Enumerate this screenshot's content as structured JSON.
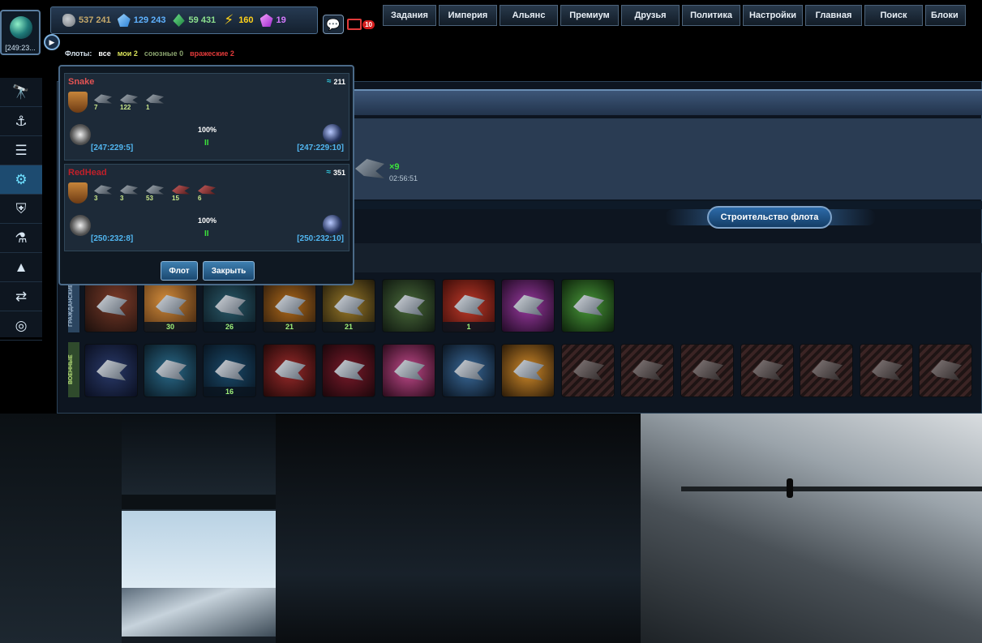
{
  "planet": {
    "coords": "[249:23..."
  },
  "resources": [
    {
      "name": "metal",
      "value": "537 241",
      "color": "#c4a86a",
      "icon": "metal-icon"
    },
    {
      "name": "crystal",
      "value": "129 243",
      "color": "#5fb2ff",
      "icon": "crystal-icon"
    },
    {
      "name": "deuterium",
      "value": "59 431",
      "color": "#8ce08e",
      "icon": "deuterium-icon"
    },
    {
      "name": "energy",
      "value": "160",
      "color": "#ffd21a",
      "icon": "energy-icon"
    },
    {
      "name": "dark_matter",
      "value": "19",
      "color": "#d77aff",
      "icon": "dark-matter-icon"
    }
  ],
  "mail": {
    "count": "10"
  },
  "fleets": {
    "label": "Флоты:",
    "all": "все",
    "my": "мои 2",
    "ally": "союзные 0",
    "enemy": "вражеские 2"
  },
  "nav": [
    "Задания",
    "Империя",
    "Альянс",
    "Премиум",
    "Друзья",
    "Политика",
    "Настройки",
    "Главная",
    "Поиск",
    "Блоки"
  ],
  "sidebar": [
    "galaxy-icon",
    "buildings-icon",
    "list-icon",
    "gear-icon",
    "shield-icon",
    "research-icon",
    "rocket-icon",
    "trade-icon",
    "target-icon"
  ],
  "popup": {
    "fleets": [
      {
        "name": "Snake",
        "power": "211",
        "ships": [
          "7",
          "122",
          "1"
        ],
        "percent": "100%",
        "progress": "II",
        "from": "[247:229:5]",
        "to": "[247:229:10]"
      },
      {
        "name": "RedHead",
        "power": "351",
        "ships": [
          "3",
          "3",
          "53",
          "15",
          "6"
        ],
        "percent": "100%",
        "progress": "II",
        "from": "[250:232:8]",
        "to": "[250:232:10]"
      }
    ],
    "fleet_button": "Флот",
    "close_button": "Закрыть"
  },
  "queue": {
    "count": "×9",
    "time": "02:56:51"
  },
  "build": {
    "title": "Строительство флота"
  },
  "rows": {
    "civil_label": "ГРАЖДАНСКИЕ",
    "military_label": "ВОЕННЫЕ",
    "civil": [
      "",
      "30",
      "26",
      "21",
      "21",
      "",
      "1",
      "",
      ""
    ],
    "military": [
      "",
      "",
      "16",
      "",
      "",
      "",
      "",
      "",
      "",
      "",
      "",
      "",
      "",
      "",
      ""
    ]
  }
}
